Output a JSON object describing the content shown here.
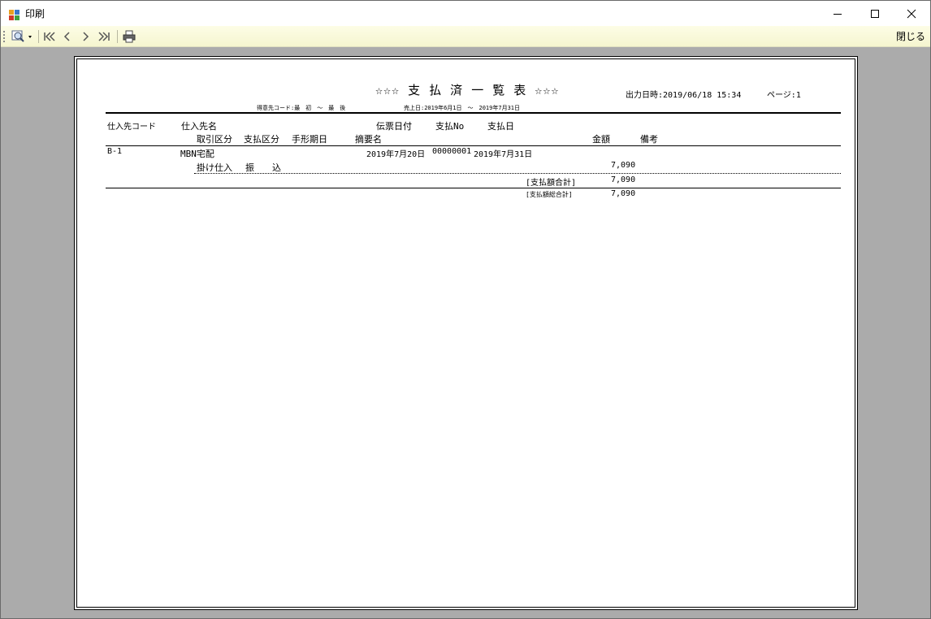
{
  "window": {
    "title": "印刷"
  },
  "toolbar": {
    "close_label": "閉じる"
  },
  "report": {
    "title": "☆☆☆ 支 払 済 一 覧 表 ☆☆☆",
    "output_datetime": "出力日時:2019/06/18 15:34",
    "page_label": "ページ:1",
    "customer_range": "得意先コード:最　初　～　最　後",
    "sales_date_range": "売上日:2019年6月1日　～　2019年7月31日",
    "headers": {
      "supplier_code": "仕入先コード",
      "supplier_name": "仕入先名",
      "slip_date": "伝票日付",
      "payment_no": "支払No",
      "payment_date": "支払日",
      "transaction_type": "取引区分",
      "payment_type": "支払区分",
      "bill_due_date": "手形期日",
      "summary_name": "摘要名",
      "amount": "金額",
      "remarks": "備考"
    },
    "record": {
      "supplier_code": "B-1",
      "supplier_name": "MBN宅配",
      "slip_date": "2019年7月20日",
      "payment_no": "00000001",
      "payment_date": "2019年7月31日",
      "transaction_type": "掛け仕入",
      "payment_type": "振　　込",
      "amount": "7,090"
    },
    "subtotal_label": "[支払額合計]",
    "subtotal_amount": "7,090",
    "grand_total_label": "[支払額総合計]",
    "grand_total_amount": "7,090"
  },
  "icons": {
    "app": "printer-window-icon",
    "zoom": "magnifier-icon",
    "first": "first-page-icon",
    "prev": "previous-page-icon",
    "next": "next-page-icon",
    "last": "last-page-icon",
    "print": "printer-icon"
  }
}
